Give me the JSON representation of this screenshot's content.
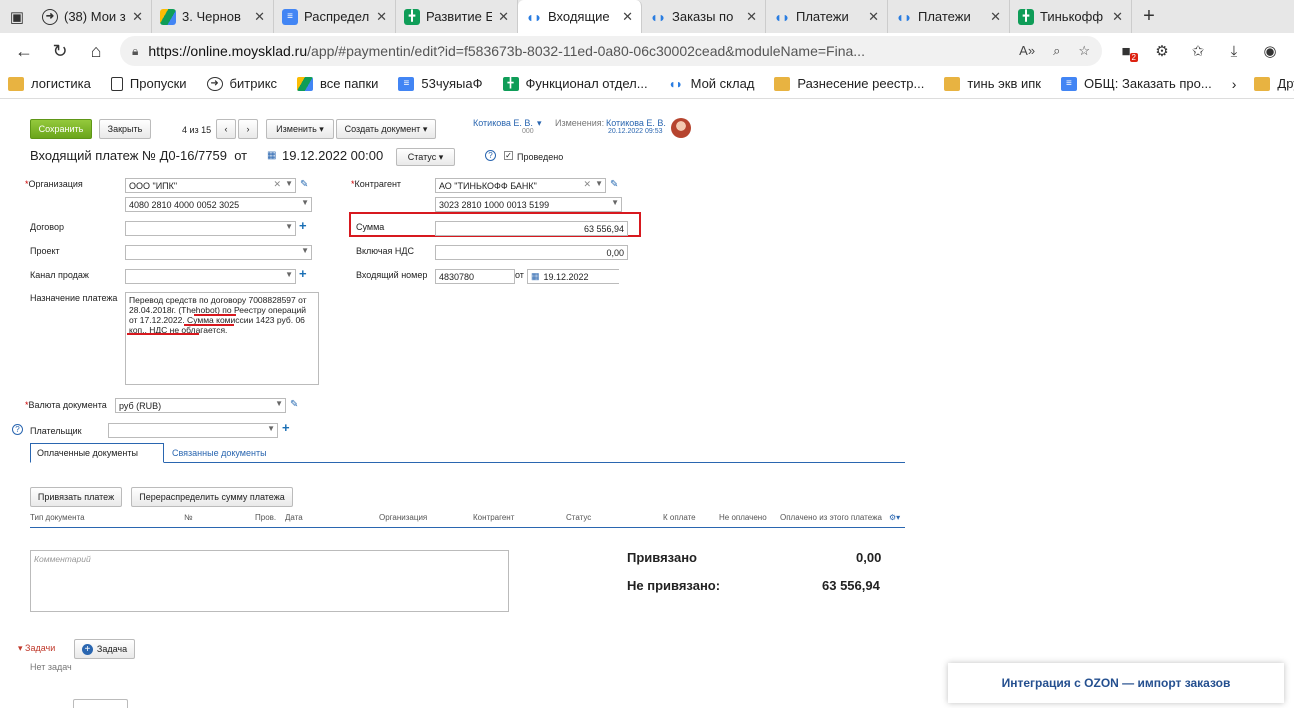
{
  "browser": {
    "tabs": [
      {
        "title": "(38) Мои з",
        "icon": "youtube-icon",
        "color": "#222"
      },
      {
        "title": "3. Чернов",
        "icon": "google-drive-icon",
        "color": "#1fa463"
      },
      {
        "title": "Распредел",
        "icon": "google-docs-icon",
        "color": "#4285f4"
      },
      {
        "title": "Развитие Е",
        "icon": "google-sheets-icon",
        "color": "#0f9d58"
      },
      {
        "title": "Входящие",
        "icon": "moysklad-icon",
        "color": "#2a7de1"
      },
      {
        "title": "Заказы по",
        "icon": "moysklad-icon",
        "color": "#2a7de1"
      },
      {
        "title": "Платежи",
        "icon": "moysklad-icon",
        "color": "#2a7de1"
      },
      {
        "title": "Платежи",
        "icon": "moysklad-icon",
        "color": "#2a7de1"
      },
      {
        "title": "Тинькофф",
        "icon": "google-sheets-icon",
        "color": "#0f9d58"
      }
    ],
    "url_host": "https://online.moysklad.ru",
    "url_path": "/app/#paymentin/edit?id=f583673b-8032-11ed-0a80-06c30002cead&moduleName=Fina...",
    "ext_badge": "2",
    "bookmarks": [
      {
        "label": "логистика",
        "icon": "folder-icon"
      },
      {
        "label": "Пропуски",
        "icon": "page-icon"
      },
      {
        "label": "битрикс",
        "icon": "arrow-circle-icon"
      },
      {
        "label": "все папки",
        "icon": "google-drive-icon"
      },
      {
        "label": "53чуяыаФ",
        "icon": "google-docs-icon"
      },
      {
        "label": "Функционал отдел...",
        "icon": "google-sheets-icon"
      },
      {
        "label": "Мой склад",
        "icon": "moysklad-icon"
      },
      {
        "label": "Разнесение реестр...",
        "icon": "folder-icon"
      },
      {
        "label": "тинь экв ипк",
        "icon": "folder-icon"
      },
      {
        "label": "ОБЩ: Заказать про...",
        "icon": "google-docs-icon"
      }
    ],
    "other_bookmarks": "Другое"
  },
  "toolbar": {
    "save": "Сохранить",
    "close": "Закрыть",
    "counter": "4 из 15",
    "change": "Изменить",
    "create_doc": "Создать документ",
    "user": "Котикова Е. В.",
    "user_sub": "000",
    "changes_label": "Изменения:",
    "changes_user": "Котикова Е. В.",
    "changes_date": "20.12.2022 09:53"
  },
  "doc": {
    "title": "Входящий платеж №",
    "number": "Д0-16/7759",
    "from": "от",
    "date": "19.12.2022 00:00",
    "status": "Статус",
    "posted": "Проведено"
  },
  "left": {
    "org_label": "Организация",
    "org_value": "ООО \"ИПК\"",
    "org_account": "4080 2810 4000 0052 3025",
    "contract_label": "Договор",
    "project_label": "Проект",
    "channel_label": "Канал продаж",
    "purpose_label": "Назначение платежа",
    "purpose_text": "Перевод средств по договору 7008828597 от 28.04.2018г. (Thehobot) по Реестру операций от 17.12.2022. Сумма комиссии 1423 руб. 06 коп., НДС не облагается.",
    "currency_label": "Валюта документа",
    "currency_value": "руб (RUB)",
    "payer_label": "Плательщик"
  },
  "right": {
    "counterparty_label": "Контрагент",
    "counterparty_value": "АО \"ТИНЬКОФФ БАНК\"",
    "counterparty_account": "3023 2810 1000 0013 5199",
    "sum_label": "Сумма",
    "sum_value": "63 556,94",
    "vat_label": "Включая НДС",
    "vat_value": "0,00",
    "incoming_label": "Входящий номер",
    "incoming_value": "4830780",
    "incoming_from": "от",
    "incoming_date": "19.12.2022"
  },
  "sections": {
    "tab_paid": "Оплаченные документы",
    "tab_linked": "Связанные документы",
    "bind_btn": "Привязать платеж",
    "redistribute_btn": "Перераспределить сумму платежа",
    "cols": [
      "Тип документа",
      "№",
      "Пров.",
      "Дата",
      "Организация",
      "Контрагент",
      "Статус",
      "К оплате",
      "Не оплачено",
      "Оплачено из этого платежа"
    ],
    "comment_placeholder": "Комментарий",
    "bound_label": "Привязано",
    "bound_value": "0,00",
    "unbound_label": "Не привязано:",
    "unbound_value": "63 556,94",
    "tasks_label": "Задачи",
    "task_btn": "Задача",
    "no_tasks": "Нет задач"
  },
  "toast": "Интеграция с OZON — импорт заказов"
}
